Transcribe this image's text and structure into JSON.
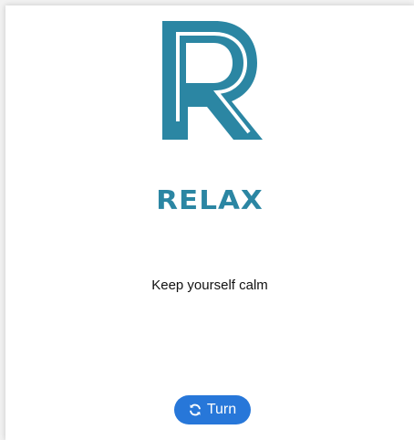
{
  "brand": {
    "logo_icon": "r-monogram-logo",
    "name": "RELAX",
    "color": "#2b86a3"
  },
  "content": {
    "tagline": "Keep yourself calm"
  },
  "actions": {
    "turn_label": "Turn",
    "turn_icon": "sync-icon",
    "button_color": "#2777d9"
  }
}
